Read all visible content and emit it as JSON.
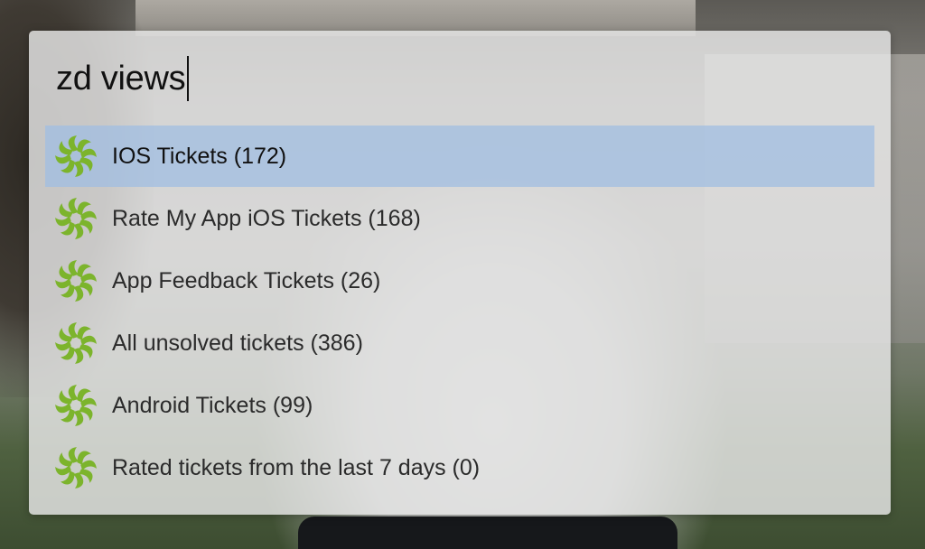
{
  "search": {
    "query": "zd views"
  },
  "results": {
    "icon": "zendesk-logo-icon",
    "accent_color": "#7cb42c",
    "selected_index": 0,
    "items": [
      {
        "label": "IOS Tickets (172)"
      },
      {
        "label": "Rate My App iOS Tickets (168)"
      },
      {
        "label": "App Feedback Tickets (26)"
      },
      {
        "label": "All unsolved tickets (386)"
      },
      {
        "label": "Android Tickets (99)"
      },
      {
        "label": "Rated tickets from the last 7 days (0)"
      }
    ]
  }
}
